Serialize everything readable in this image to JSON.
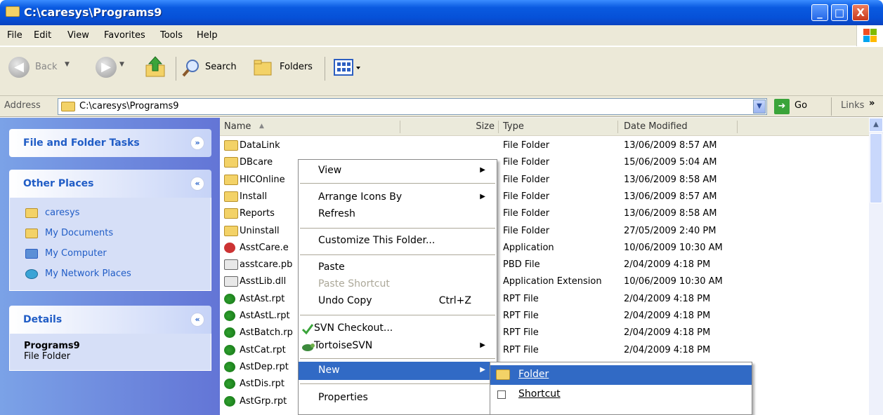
{
  "window": {
    "title": "C:\\caresys\\Programs9",
    "minimize": "_",
    "maximize": "□",
    "close": "X"
  },
  "menubar": [
    "File",
    "Edit",
    "View",
    "Favorites",
    "Tools",
    "Help"
  ],
  "toolbar": {
    "back": "Back",
    "search": "Search",
    "folders": "Folders"
  },
  "address": {
    "label": "Address",
    "path": "C:\\caresys\\Programs9",
    "go": "Go",
    "links": "Links",
    "links_chevron": "»"
  },
  "tasks": {
    "file_folder": {
      "title": "File and Folder Tasks"
    },
    "other_places": {
      "title": "Other Places",
      "items": [
        "caresys",
        "My Documents",
        "My Computer",
        "My Network Places"
      ]
    },
    "details": {
      "title": "Details",
      "name": "Programs9",
      "type": "File Folder"
    }
  },
  "columns": {
    "name": "Name",
    "size": "Size",
    "type": "Type",
    "date": "Date Modified"
  },
  "files": [
    {
      "name": "DataLink",
      "type": "File Folder",
      "date": "13/06/2009 8:57 AM",
      "icon": "folder"
    },
    {
      "name": "DBcare",
      "type": "File Folder",
      "date": "15/06/2009 5:04 AM",
      "icon": "folder"
    },
    {
      "name": "HICOnline",
      "type": "File Folder",
      "date": "13/06/2009 8:58 AM",
      "icon": "folder"
    },
    {
      "name": "Install",
      "type": "File Folder",
      "date": "13/06/2009 8:57 AM",
      "icon": "folder"
    },
    {
      "name": "Reports",
      "type": "File Folder",
      "date": "13/06/2009 8:58 AM",
      "icon": "folder"
    },
    {
      "name": "Uninstall",
      "type": "File Folder",
      "date": "27/05/2009 2:40 PM",
      "icon": "folder"
    },
    {
      "name": "AsstCare.e",
      "type": "Application",
      "date": "10/06/2009 10:30 AM",
      "icon": "app"
    },
    {
      "name": "asstcare.pb",
      "type": "PBD File",
      "date": "2/04/2009 4:18 PM",
      "icon": "doc"
    },
    {
      "name": "AsstLib.dll",
      "type": "Application Extension",
      "date": "10/06/2009 10:30 AM",
      "icon": "doc"
    },
    {
      "name": "AstAst.rpt",
      "type": "RPT File",
      "date": "2/04/2009 4:18 PM",
      "icon": "rpt"
    },
    {
      "name": "AstAstL.rpt",
      "type": "RPT File",
      "date": "2/04/2009 4:18 PM",
      "icon": "rpt"
    },
    {
      "name": "AstBatch.rp",
      "type": "RPT File",
      "date": "2/04/2009 4:18 PM",
      "icon": "rpt"
    },
    {
      "name": "AstCat.rpt",
      "type": "RPT File",
      "date": "2/04/2009 4:18 PM",
      "icon": "rpt"
    },
    {
      "name": "AstDep.rpt",
      "type": "",
      "date": "",
      "icon": "rpt"
    },
    {
      "name": "AstDis.rpt",
      "type": "",
      "date": "",
      "icon": "rpt"
    },
    {
      "name": "AstGrp.rpt",
      "type": "",
      "date": "",
      "icon": "rpt"
    }
  ],
  "context_menu": {
    "view": "View",
    "arrange": "Arrange Icons By",
    "refresh": "Refresh",
    "customize": "Customize This Folder...",
    "paste": "Paste",
    "paste_shortcut": "Paste Shortcut",
    "undo": "Undo Copy",
    "undo_shortcut": "Ctrl+Z",
    "svn_checkout": "SVN Checkout...",
    "tortoise": "TortoiseSVN",
    "new": "New",
    "properties": "Properties"
  },
  "submenu": {
    "folder": "Folder",
    "shortcut": "Shortcut"
  }
}
